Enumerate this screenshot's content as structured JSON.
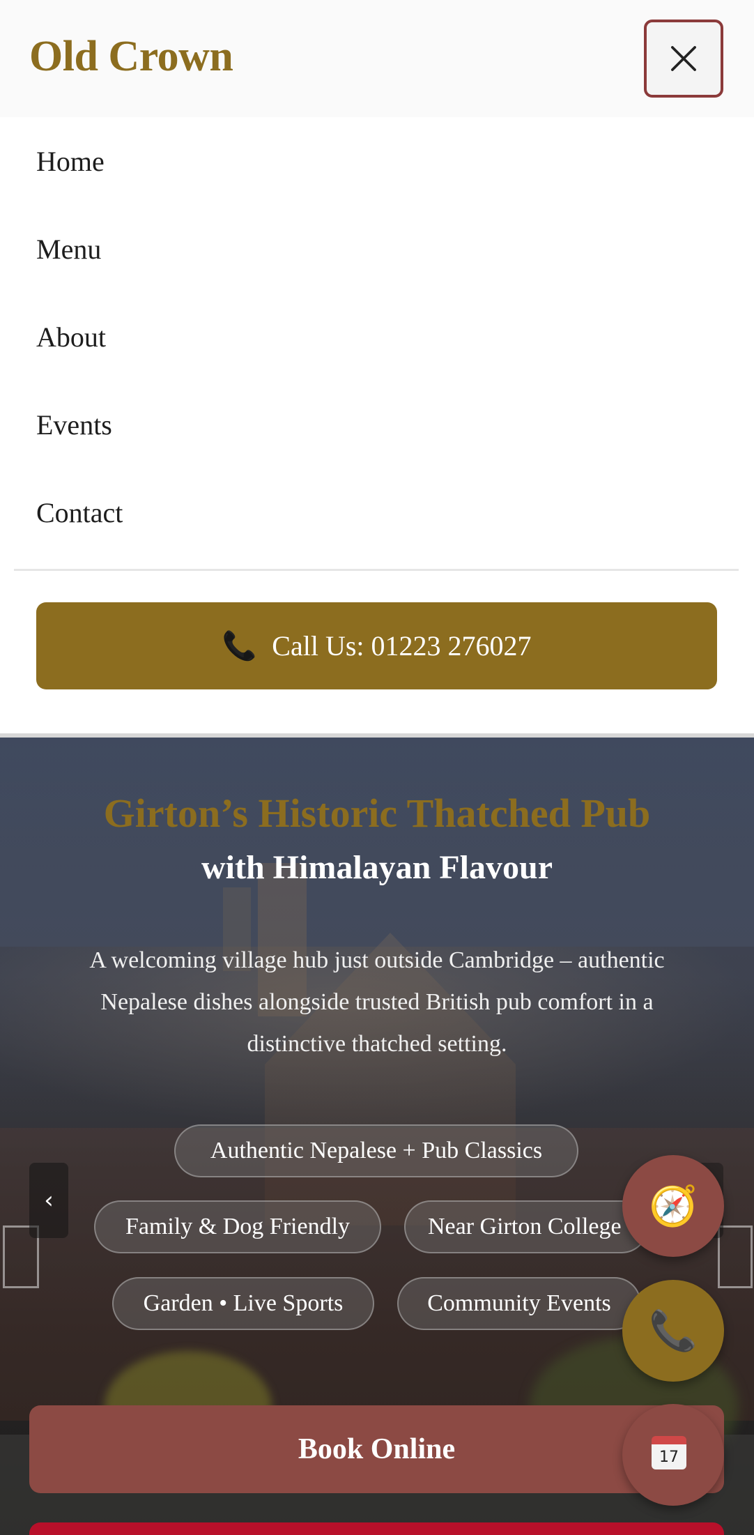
{
  "header": {
    "brand": "Old Crown",
    "close_icon": "close-icon"
  },
  "nav": {
    "items": [
      {
        "label": "Home"
      },
      {
        "label": "Menu"
      },
      {
        "label": "About"
      },
      {
        "label": "Events"
      },
      {
        "label": "Contact"
      }
    ],
    "call_button": {
      "icon": "phone-icon",
      "icon_glyph": "📞",
      "label": "Call Us: 01223 276027"
    }
  },
  "hero": {
    "title": "Girton’s Historic Thatched Pub",
    "subtitle": "with Himalayan Flavour",
    "description": "A welcoming village hub just outside Cambridge – authentic Nepalese dishes alongside trusted British pub comfort in a distinctive thatched setting.",
    "features": [
      "Authentic Nepalese + Pub Classics",
      "Family & Dog Friendly",
      "Near Girton College",
      "Garden • Live Sports",
      "Community Events"
    ],
    "carousel_prev_glyph": "‹",
    "book_button": "Book Online"
  },
  "floating_actions": {
    "compass": {
      "icon": "compass-icon",
      "glyph": "🧭"
    },
    "phone": {
      "icon": "phone-icon",
      "glyph": "📞"
    },
    "calendar": {
      "icon": "calendar-icon",
      "glyph": "17"
    }
  },
  "colors": {
    "brand_gold": "#8c6d1f",
    "accent_red": "#8c4a44",
    "bottom_red": "#b8102a"
  }
}
